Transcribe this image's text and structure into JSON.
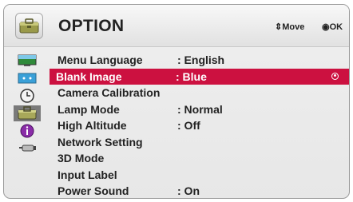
{
  "header": {
    "title": "OPTION",
    "move_hint": "Move",
    "ok_hint": "OK",
    "icon": "toolbox-icon"
  },
  "sidebar": {
    "icons": [
      "picture-icon",
      "screen-icon",
      "clock-icon",
      "option-icon",
      "info-icon",
      "input-icon"
    ],
    "active_icon": "option-icon"
  },
  "menu": {
    "items": [
      {
        "label": "Menu Language",
        "value": ": English"
      },
      {
        "label": "Blank Image",
        "value": ": Blue"
      },
      {
        "label": "Camera Calibration",
        "value": ""
      },
      {
        "label": "Lamp Mode",
        "value": ": Normal"
      },
      {
        "label": "High Altitude",
        "value": ": Off"
      },
      {
        "label": "Network Setting",
        "value": ""
      },
      {
        "label": "3D Mode",
        "value": ""
      },
      {
        "label": "Input Label",
        "value": ""
      },
      {
        "label": "Power Sound",
        "value": ": On"
      }
    ],
    "selected_label": "Blank Image"
  },
  "colors": {
    "selection": "#cc1140",
    "panel": "#ebebeb",
    "text": "#222222"
  }
}
